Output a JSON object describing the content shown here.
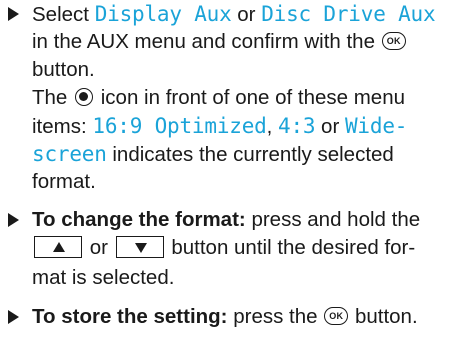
{
  "step1": {
    "select": "Select",
    "opt_display_aux": "Display Aux",
    "or": "or",
    "opt_disc_drive_aux": "Disc Drive Aux",
    "in_the_aux_menu": "in the AUX menu and confirm with the",
    "ok_label": "OK",
    "button": "button.",
    "the": "The",
    "icon_in_front": "icon in front of one of these menu",
    "items": "items:",
    "opt_16_9": "16:9 Optimized",
    "comma": ",",
    "opt_4_3": "4:3",
    "or2": "or",
    "opt_wide": "Wide-",
    "opt_screen": "screen",
    "indicates": "indicates the currently selected",
    "format": "format."
  },
  "step2": {
    "heading": "To change the format:",
    "press_hold": "press and hold the",
    "or": "or",
    "button_until": "button until the desired for-",
    "mat_selected": "mat is selected."
  },
  "step3": {
    "heading": "To store the setting:",
    "press_the": "press the",
    "ok_label": "OK",
    "button": "button."
  },
  "icons": {
    "bullet": "triangle-right-icon",
    "ok": "ok-button-icon",
    "radio": "radio-selected-icon",
    "up": "up-arrow-button-icon",
    "down": "down-arrow-button-icon"
  },
  "colors": {
    "menu_item_text": "#1aa3d8",
    "body_text": "#1a1a1a"
  }
}
